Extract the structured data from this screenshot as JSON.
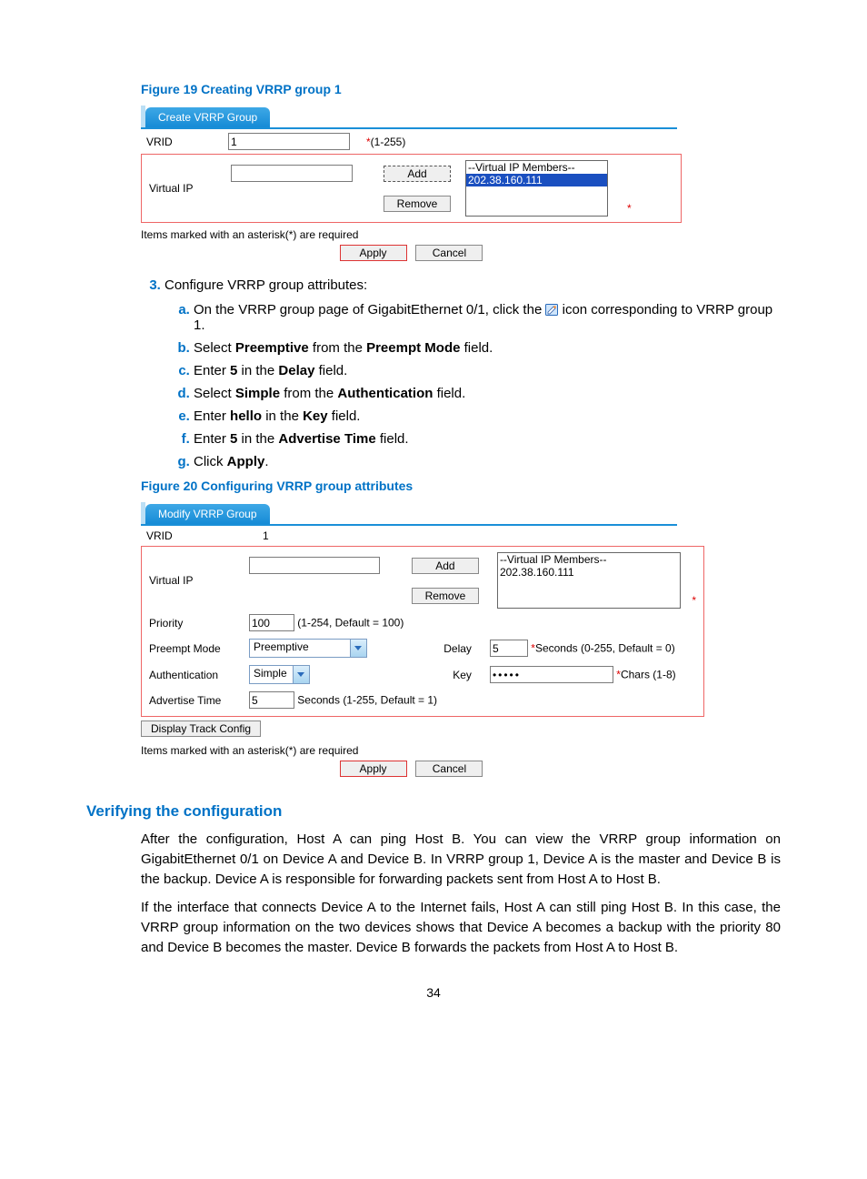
{
  "figure19": {
    "caption": "Figure 19 Creating VRRP group 1",
    "tab_label": "Create VRRP Group",
    "vrid_label": "VRID",
    "vrid_value": "1",
    "vrid_hint": "(1-255)",
    "vip_label": "Virtual IP",
    "vip_value": "",
    "add_label": "Add",
    "remove_label": "Remove",
    "members_header": "--Virtual IP Members--",
    "members_item": "202.38.160.111",
    "footnote": "Items marked with an asterisk(*) are required",
    "apply_label": "Apply",
    "cancel_label": "Cancel"
  },
  "step3": {
    "number": "3.",
    "text": "Configure VRRP group attributes:",
    "a_pre": "On the VRRP group page of GigabitEthernet 0/1, click the ",
    "a_post": " icon corresponding to VRRP group 1.",
    "b_pre": "Select ",
    "b_bold1": "Preemptive",
    "b_mid": " from the ",
    "b_bold2": "Preempt Mode",
    "b_post": " field.",
    "c_pre": "Enter ",
    "c_bold1": "5",
    "c_mid": " in the ",
    "c_bold2": "Delay",
    "c_post": " field.",
    "d_pre": "Select ",
    "d_bold1": "Simple",
    "d_mid": " from the ",
    "d_bold2": "Authentication",
    "d_post": " field.",
    "e_pre": "Enter ",
    "e_bold1": "hello",
    "e_mid": " in the ",
    "e_bold2": "Key",
    "e_post": " field.",
    "f_pre": "Enter ",
    "f_bold1": "5",
    "f_mid": " in the ",
    "f_bold2": "Advertise Time",
    "f_post": " field.",
    "g_pre": "Click ",
    "g_bold1": "Apply",
    "g_post": "."
  },
  "figure20": {
    "caption": "Figure 20 Configuring VRRP group attributes",
    "tab_label": "Modify VRRP Group",
    "vrid_label": "VRID",
    "vrid_value": "1",
    "vip_label": "Virtual IP",
    "vip_value": "",
    "add_label": "Add",
    "remove_label": "Remove",
    "members_header": "--Virtual IP Members--",
    "members_item": "202.38.160.111",
    "priority_label": "Priority",
    "priority_value": "100",
    "priority_hint": "(1-254, Default = 100)",
    "preempt_label": "Preempt Mode",
    "preempt_value": "Preemptive",
    "delay_label": "Delay",
    "delay_value": "5",
    "delay_hint": "Seconds (0-255, Default = 0)",
    "auth_label": "Authentication",
    "auth_value": "Simple",
    "key_label": "Key",
    "key_value": "•••••",
    "key_hint": "Chars (1-8)",
    "adv_label": "Advertise Time",
    "adv_value": "5",
    "adv_hint": "Seconds (1-255, Default = 1)",
    "track_label": "Display Track Config",
    "footnote": "Items marked with an asterisk(*) are required",
    "apply_label": "Apply",
    "cancel_label": "Cancel"
  },
  "verify": {
    "heading": "Verifying the configuration",
    "p1": "After the configuration, Host A can ping Host B. You can view the VRRP group information on GigabitEthernet 0/1 on Device A and Device B. In VRRP group 1, Device A is the master and Device B is the backup. Device A is responsible for forwarding packets sent from Host A to Host B.",
    "p2": "If the interface that connects Device A to the Internet fails, Host A can still ping Host B. In this case, the VRRP group information on the two devices shows that Device A becomes a backup with the priority 80 and Device B becomes the master. Device B forwards the packets from Host A to Host B."
  },
  "page_number": "34"
}
